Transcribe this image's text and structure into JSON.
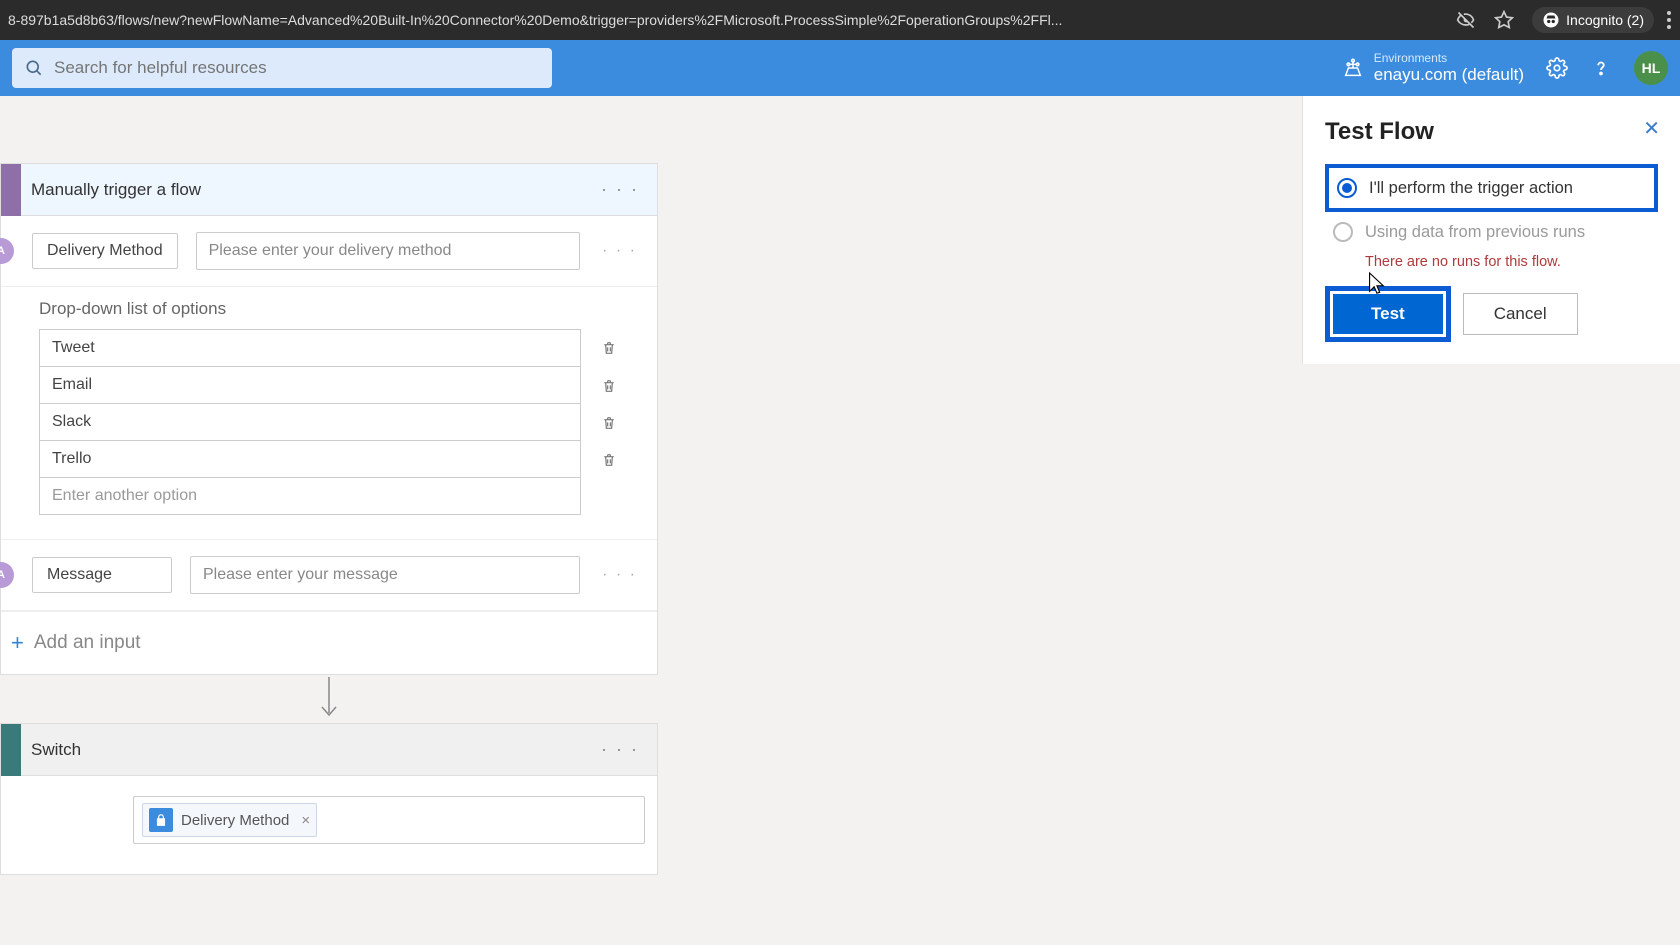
{
  "browser": {
    "url": "8-897b1a5d8b63/flows/new?newFlowName=Advanced%20Built-In%20Connector%20Demo&trigger=providers%2FMicrosoft.ProcessSimple%2FoperationGroups%2FFl...",
    "incognito_label": "Incognito (2)"
  },
  "header": {
    "search_placeholder": "Search for helpful resources",
    "env_label": "Environments",
    "env_name": "enayu.com (default)",
    "avatar_initials": "HL"
  },
  "trigger_card": {
    "title": "Manually trigger a flow",
    "param1": {
      "badge": "A",
      "name": "Delivery Method",
      "placeholder": "Please enter your delivery method"
    },
    "dropdown": {
      "label": "Drop-down list of options",
      "options": [
        "Tweet",
        "Email",
        "Slack",
        "Trello"
      ],
      "new_placeholder": "Enter another option"
    },
    "param2": {
      "badge": "A",
      "name": "Message",
      "placeholder": "Please enter your message"
    },
    "add_input": "Add an input"
  },
  "switch_card": {
    "title": "Switch",
    "token_label": "Delivery Method"
  },
  "panel": {
    "title": "Test Flow",
    "option1": "I'll perform the trigger action",
    "option2": "Using data from previous runs",
    "no_runs": "There are no runs for this flow.",
    "test_label": "Test",
    "cancel_label": "Cancel"
  }
}
